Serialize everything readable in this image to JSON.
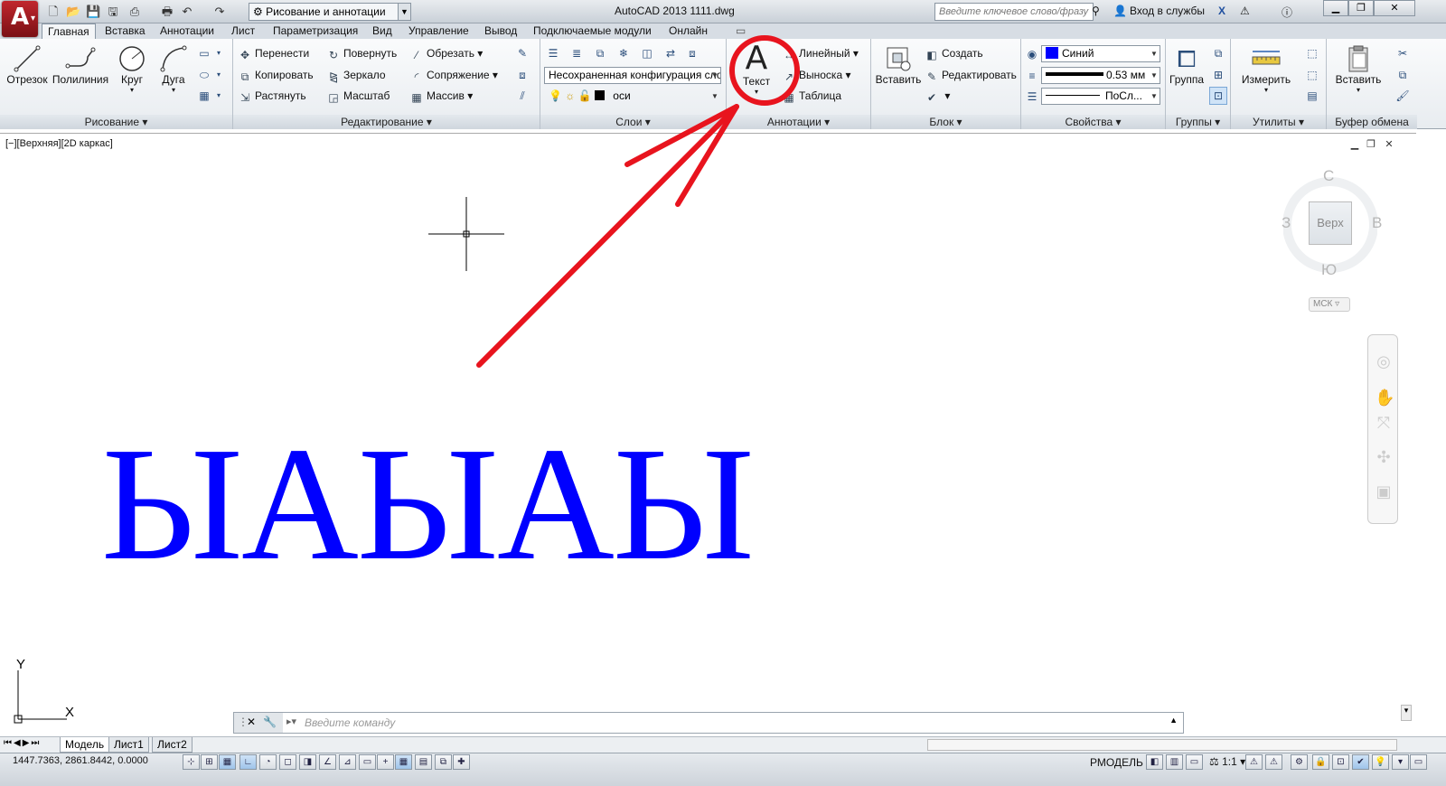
{
  "window": {
    "title": "AutoCAD 2013    1111.dwg",
    "app_letter": "A",
    "workspace": "Рисование и аннотации",
    "search_placeholder": "Введите ключевое слово/фразу",
    "signin": "Вход в службы"
  },
  "ribbon_tabs": [
    "Главная",
    "Вставка",
    "Аннотации",
    "Лист",
    "Параметризация",
    "Вид",
    "Управление",
    "Вывод",
    "Подключаемые модули",
    "Онлайн"
  ],
  "draw_panel": {
    "title": "Рисование",
    "line": "Отрезок",
    "polyline": "Полилиния",
    "circle": "Круг",
    "arc": "Дуга"
  },
  "modify_panel": {
    "title": "Редактирование",
    "move": "Перенести",
    "copy": "Копировать",
    "stretch": "Растянуть",
    "rotate": "Повернуть",
    "mirror": "Зеркало",
    "scale": "Масштаб",
    "trim": "Обрезать",
    "fillet": "Сопряжение",
    "array": "Массив"
  },
  "layers_panel": {
    "title": "Слои",
    "layer_state": "Несохраненная конфигурация сло",
    "current_layer": "оси"
  },
  "annotation_panel": {
    "title": "Аннотации",
    "text": "Текст",
    "dimension": "Линейный",
    "leader": "Выноска",
    "table": "Таблица"
  },
  "block_panel": {
    "title": "Блок",
    "insert": "Вставить",
    "create": "Создать",
    "edit": "Редактировать"
  },
  "properties_panel": {
    "title": "Свойства",
    "color": "Синий",
    "color_hex": "#0000ff",
    "lineweight": "0.53 мм",
    "linetype": "ПоСл..."
  },
  "groups_panel": {
    "title": "Группы",
    "group": "Группа"
  },
  "utilities_panel": {
    "title": "Утилиты",
    "measure": "Измерить"
  },
  "clipboard_panel": {
    "title": "Буфер обмена",
    "paste": "Вставить"
  },
  "viewport": {
    "label": "[−][Верхняя][2D каркас]",
    "drawing_text": "ЫАЫАЫ",
    "drawing_color": "#0000ff"
  },
  "viewcube": {
    "top": "Верх",
    "north": "С",
    "south": "Ю",
    "west": "З",
    "east": "В",
    "ucs": "МСК"
  },
  "ucs_icon": {
    "x": "X",
    "y": "Y"
  },
  "command_line": {
    "placeholder": "Введите  команду"
  },
  "layout_tabs": [
    "Модель",
    "Лист1",
    "Лист2"
  ],
  "status": {
    "coordinates": "1447.7363, 2861.8442, 0.0000",
    "space": "РМОДЕЛЬ",
    "annotation_scale": "1:1"
  },
  "highlight_color": "#e8141e"
}
